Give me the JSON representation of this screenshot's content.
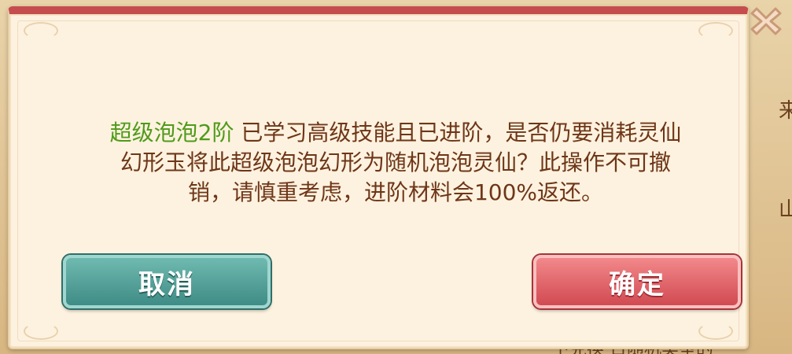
{
  "dialog": {
    "highlight_name": "超级泡泡2阶",
    "message_line1": " 已学习高级技能且已进阶，是否仍要消耗灵仙",
    "message_line2": "幻形玉将此超级泡泡幻形为随机泡泡灵仙？此操作不可撤",
    "message_line3": "销，请慎重考虑，进阶材料会100%返还。",
    "cancel_label": "取消",
    "confirm_label": "确定",
    "close_icon": "close-icon"
  },
  "background": {
    "fragment_right_1": "来",
    "fragment_right_2": "山",
    "fragment_bottom": "一下兑换   日随机类型的"
  },
  "colors": {
    "highlight": "#4f9a1a",
    "text": "#6e3618",
    "cancel": "#3f8c86",
    "confirm": "#d14a52",
    "header_bar": "#c64d4d"
  }
}
